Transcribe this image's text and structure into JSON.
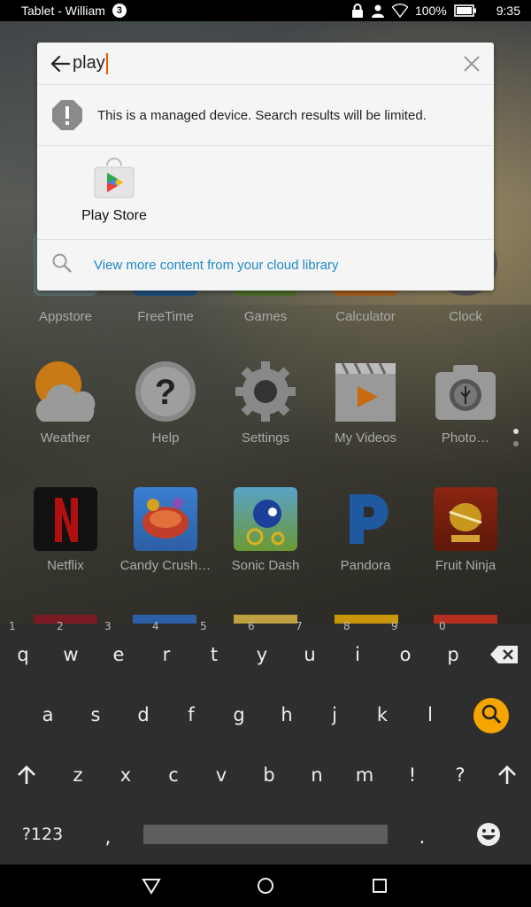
{
  "status_bar": {
    "title": "Tablet - William",
    "notification_count": "3",
    "battery_percent": "100%",
    "time": "9:35",
    "icons": [
      "lock-icon",
      "profile-icon",
      "wifi-icon",
      "battery-icon"
    ]
  },
  "search": {
    "query": "play",
    "notice": "This is a managed device. Search results will be limited.",
    "results": [
      {
        "label": "Play Store",
        "icon": "play-store-icon"
      }
    ],
    "more_link": "View more content from your cloud library"
  },
  "home": {
    "row1": [
      "Appstore",
      "FreeTime",
      "Games",
      "Calculator",
      "Clock"
    ],
    "row2": [
      "Weather",
      "Help",
      "Settings",
      "My Videos",
      "Photo…"
    ],
    "row3": [
      "Netflix",
      "Candy Crush…",
      "Sonic Dash",
      "Pandora",
      "Fruit Ninja"
    ]
  },
  "keyboard": {
    "row1": [
      "q",
      "w",
      "e",
      "r",
      "t",
      "y",
      "u",
      "i",
      "o",
      "p"
    ],
    "row1_hints": [
      "1",
      "2",
      "3",
      "4",
      "5",
      "6",
      "7",
      "8",
      "9",
      "0"
    ],
    "row2": [
      "a",
      "s",
      "d",
      "f",
      "g",
      "h",
      "j",
      "k",
      "l"
    ],
    "row3": [
      "z",
      "x",
      "c",
      "v",
      "b",
      "n",
      "m",
      "!",
      "?"
    ],
    "symbols_label": "?123",
    "comma": ",",
    "period": ".",
    "accent_color": "#f6a400"
  },
  "nav": {
    "icons": [
      "back-icon",
      "home-icon",
      "recents-icon"
    ]
  }
}
